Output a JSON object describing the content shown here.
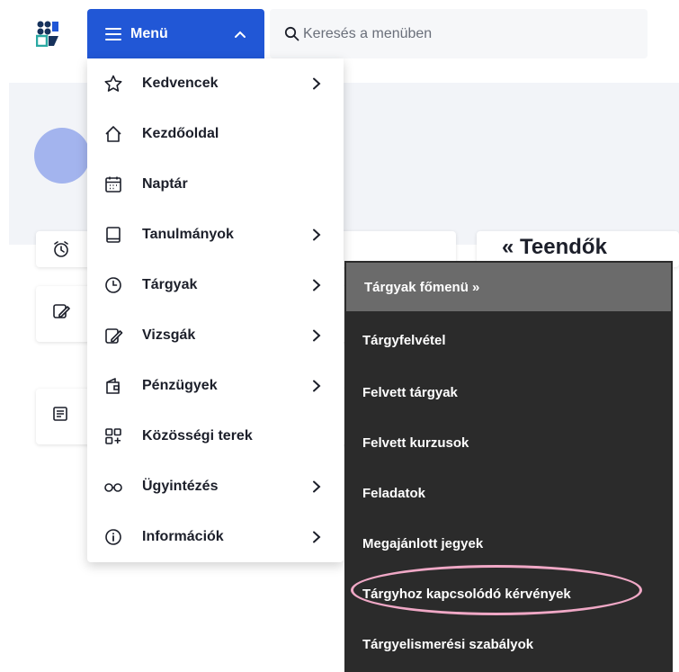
{
  "topbar": {
    "logo_icon": "university-logo-icon",
    "menu_label": "Menü",
    "search_placeholder": "Keresés a menüben"
  },
  "menu": {
    "items": [
      {
        "label": "Kedvencek",
        "icon": "star-icon",
        "has_submenu": true
      },
      {
        "label": "Kezdőoldal",
        "icon": "home-icon",
        "has_submenu": false
      },
      {
        "label": "Naptár",
        "icon": "calendar-icon",
        "has_submenu": false
      },
      {
        "label": "Tanulmányok",
        "icon": "book-icon",
        "has_submenu": true
      },
      {
        "label": "Tárgyak",
        "icon": "clock-icon",
        "has_submenu": true
      },
      {
        "label": "Vizsgák",
        "icon": "exam-pen-icon",
        "has_submenu": true
      },
      {
        "label": "Pénzügyek",
        "icon": "wallet-icon",
        "has_submenu": true
      },
      {
        "label": "Közösségi terek",
        "icon": "grid-plus-icon",
        "has_submenu": false
      },
      {
        "label": "Ügyintézés",
        "icon": "glasses-icon",
        "has_submenu": true
      },
      {
        "label": "Információk",
        "icon": "info-icon",
        "has_submenu": true
      }
    ]
  },
  "submenu": {
    "items": [
      {
        "label": "Tárgyak főmenü »"
      },
      {
        "label": "Tárgyfelvétel"
      },
      {
        "label": "Felvett tárgyak"
      },
      {
        "label": "Felvett kurzusok"
      },
      {
        "label": "Feladatok"
      },
      {
        "label": "Megajánlott jegyek"
      },
      {
        "label": "Tárgyhoz kapcsolódó kérvények"
      },
      {
        "label": "Tárgyelismerési szabályok"
      }
    ],
    "highlighted_item": "Tárgyhoz kapcsolódó kérvények"
  },
  "background": {
    "todo_title_partial": "« Teendők"
  },
  "colors": {
    "accent": "#2157d6",
    "submenu_bg": "#2b2b2b",
    "submenu_head_bg": "#6b6b6b",
    "highlight_ring": "#f0a8c6",
    "avatar": "#a3b4ee"
  }
}
